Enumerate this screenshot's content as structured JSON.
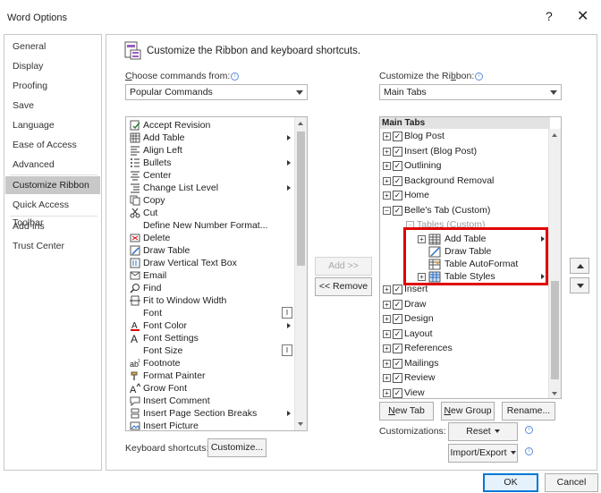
{
  "window": {
    "title": "Word Options",
    "help": "?",
    "close": "✕"
  },
  "nav": {
    "items": [
      {
        "label": "General"
      },
      {
        "label": "Display"
      },
      {
        "label": "Proofing"
      },
      {
        "label": "Save"
      },
      {
        "label": "Language"
      },
      {
        "label": "Ease of Access"
      },
      {
        "label": "Advanced"
      },
      {
        "label": "Customize Ribbon"
      },
      {
        "label": "Quick Access Toolbar"
      },
      {
        "label": "Add-ins"
      },
      {
        "label": "Trust Center"
      }
    ],
    "selected": "Customize Ribbon"
  },
  "header": {
    "title": "Customize the Ribbon and keyboard shortcuts."
  },
  "left": {
    "choose_label": "hoose commands from:",
    "choose_label_prefix": "C",
    "choose_value": "Popular Commands",
    "commands": [
      {
        "label": "Accept Revision",
        "icon": "accept-revision-icon"
      },
      {
        "label": "Add Table",
        "icon": "table-icon",
        "submenu": true
      },
      {
        "label": "Align Left",
        "icon": "align-left-icon"
      },
      {
        "label": "Bullets",
        "icon": "bullets-icon",
        "split": true
      },
      {
        "label": "Center",
        "icon": "align-center-icon"
      },
      {
        "label": "Change List Level",
        "icon": "list-level-icon",
        "submenu": true
      },
      {
        "label": "Copy",
        "icon": "copy-icon"
      },
      {
        "label": "Cut",
        "icon": "scissors-icon"
      },
      {
        "label": "Define New Number Format...",
        "icon": ""
      },
      {
        "label": "Delete",
        "icon": "delete-icon"
      },
      {
        "label": "Draw Table",
        "icon": "draw-table-icon"
      },
      {
        "label": "Draw Vertical Text Box",
        "icon": "text-box-icon"
      },
      {
        "label": "Email",
        "icon": "email-icon"
      },
      {
        "label": "Find",
        "icon": "search-icon"
      },
      {
        "label": "Fit to Window Width",
        "icon": "fit-width-icon"
      },
      {
        "label": "Font",
        "icon": "",
        "fieldbox": true
      },
      {
        "label": "Font Color",
        "icon": "font-color-icon",
        "split": true
      },
      {
        "label": "Font Settings",
        "icon": "font-settings-icon"
      },
      {
        "label": "Font Size",
        "icon": "",
        "fieldbox": true
      },
      {
        "label": "Footnote",
        "icon": "footnote-icon"
      },
      {
        "label": "Format Painter",
        "icon": "format-painter-icon"
      },
      {
        "label": "Grow Font",
        "icon": "grow-font-icon"
      },
      {
        "label": "Insert Comment",
        "icon": "comment-icon"
      },
      {
        "label": "Insert Page  Section Breaks",
        "icon": "page-break-icon",
        "submenu": true
      },
      {
        "label": "Insert Picture",
        "icon": "picture-icon"
      }
    ],
    "shortcuts_label": "Keyboard shortcuts:",
    "customize_button": "Customize..."
  },
  "middle": {
    "add_button": "Add >>",
    "remove_button": "<< Remove"
  },
  "right": {
    "customize_label": "Customize the Ri",
    "customize_label_u": "b",
    "customize_label_end": "bon:",
    "customize_value": "Main Tabs",
    "tree_header": "Main Tabs",
    "tabs_top": [
      {
        "label": "Blog Post"
      },
      {
        "label": "Insert (Blog Post)"
      },
      {
        "label": "Outlining"
      },
      {
        "label": "Background Removal"
      },
      {
        "label": "Home"
      },
      {
        "label": "Belle's Tab (Custom)"
      }
    ],
    "custom_group": "Tables (Custom)",
    "group_items": [
      {
        "label": "Add Table",
        "icon": "table-icon"
      },
      {
        "label": "Draw Table",
        "icon": "draw-table-icon"
      },
      {
        "label": "Table AutoFormat",
        "icon": "table-autoformat-icon"
      },
      {
        "label": "Table Styles",
        "icon": "table-styles-icon"
      }
    ],
    "tabs_bottom": [
      {
        "label": "Insert"
      },
      {
        "label": "Draw"
      },
      {
        "label": "Design"
      },
      {
        "label": "Layout"
      },
      {
        "label": "References"
      },
      {
        "label": "Mailings"
      },
      {
        "label": "Review"
      },
      {
        "label": "View"
      }
    ],
    "new_tab_button": "New Tab",
    "new_group_button": "New Group",
    "rename_button": "Rename...",
    "customizations_label": "Customizations:",
    "reset_button": "Reset",
    "import_export_button": "Import/Export"
  },
  "footer": {
    "ok_button": "OK",
    "cancel_button": "Cancel"
  },
  "colors": {
    "highlight": "#e00000",
    "accent": "#0078d7",
    "selected_nav": "#c8c8c8"
  }
}
